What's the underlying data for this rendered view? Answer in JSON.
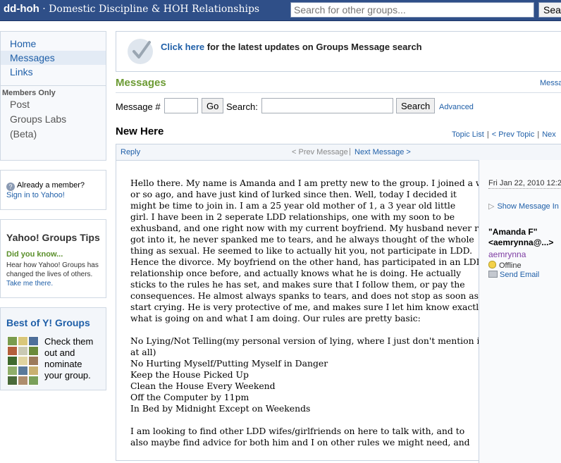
{
  "header": {
    "group_id": "dd-hoh",
    "group_title": " · Domestic Discipline & HOH Relationships",
    "search_placeholder": "Search for other groups...",
    "search_button": "Sea"
  },
  "sidebar": {
    "nav": [
      "Home",
      "Messages",
      "Links"
    ],
    "members_only_label": "Members Only",
    "members_items": [
      "Post",
      "Groups Labs",
      "(Beta)"
    ],
    "already_member": "Already a member?",
    "sign_in": "Sign in to Yahoo!",
    "tips_title": "Yahoo! Groups Tips",
    "did_you_know": "Did you know...",
    "tip_text": "Hear how Yahoo! Groups has changed the lives of others.",
    "tip_link": "Take me there.",
    "best_title": "Best of Y! Groups",
    "best_text": "Check them out and nominate your group.",
    "thumb_colors": [
      "#7a9c4e",
      "#d9c77a",
      "#4e6f9a",
      "#b45f3c",
      "#c9c9b3",
      "#6a8a3a",
      "#3f6a2e",
      "#e0d4a0",
      "#9c7a5a",
      "#8fae6a",
      "#5a7a9a",
      "#c8b070",
      "#4a6a3a",
      "#ae8e6e",
      "#7aa05a"
    ]
  },
  "banner": {
    "link": "Click here",
    "text": " for the latest updates on Groups Message search"
  },
  "messages": {
    "title": "Messages",
    "right_link": "Messa",
    "msg_num_label": "Message #",
    "go": "Go",
    "search_label": "Search:",
    "search_button": "Search",
    "advanced": "Advanced"
  },
  "thread": {
    "title": "New Here",
    "topic_list": "Topic List",
    "prev_topic": "< Prev Topic",
    "next": "Nex",
    "sep": "|",
    "reply": "Reply",
    "prev_message": "< Prev Message",
    "next_message": "Next Message >",
    "bar_sep": "|"
  },
  "message": {
    "lines1": [
      "Hello there. My name is Amanda and I am pretty new to the group. I joined a week",
      "or so ago, and have just kind of lurked since then. Well, today I decided it",
      "might be time to join in. I am a 25 year old mother of 1, a 3 year old little",
      "girl. I have been in 2 seperate LDD relationships, one with my soon to be",
      "exhusband, and one right now with my current boyfriend. My husband never really",
      "got into it, he never spanked me to tears, and he always thought of the whole",
      "thing as sexual. He seemed to like to actually hit you, not participate in LDD.",
      "Hence the divorce. My boyfriend on the other hand, has participated in an LDD",
      "relationship once before, and actually knows what he is doing. He actually",
      "sticks to the rules he has set, and makes sure that I follow them, or pay the",
      "consequences. He almost always spanks to tears, and does not stop as soon as I",
      "start crying. He is very protective of me, and makes sure I let him know exactly",
      "what is going on and what I am doing. Our rules are pretty basic:"
    ],
    "rules": [
      "No Lying/Not Telling(my personal version of lying, where I just don't mention it",
      "at all)",
      "No Hurting Myself/Putting Myself in Danger",
      "Keep the House Picked Up",
      "Clean the House Every Weekend",
      "Off the Computer by 11pm",
      "In Bed by Midnight Except on Weekends"
    ],
    "lines3": [
      "I am looking to find other LDD wifes/girlfriends on here to talk with, and to",
      "also maybe find advice for both him and I on other rules we might need, and"
    ]
  },
  "sender": {
    "date": "Fri Jan 22, 2010 12:2",
    "show_header": "Show Message In",
    "name_line1": "\"Amanda F\"",
    "name_line2": "<aemrynna@...>",
    "nickname": "aemrynna",
    "status": "Offline",
    "send_email": "Send Email"
  }
}
